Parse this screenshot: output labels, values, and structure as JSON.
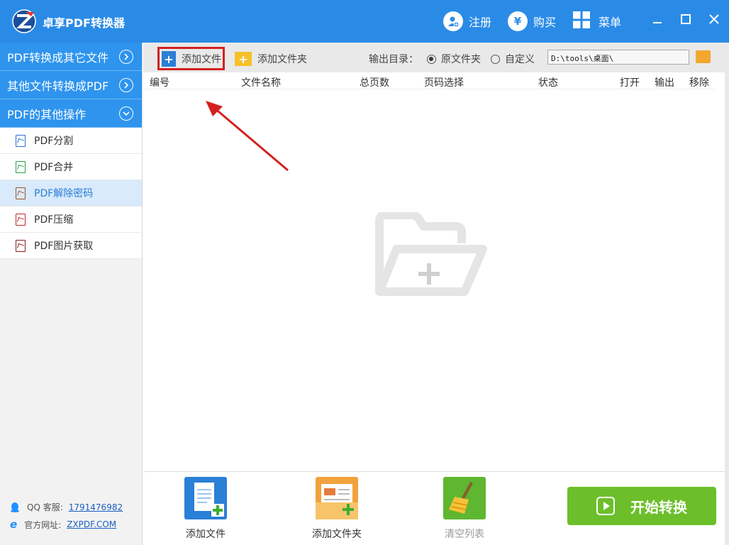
{
  "app": {
    "title": "卓享PDF转换器"
  },
  "titlebar": {
    "register": "注册",
    "buy": "购买",
    "menu": "菜单",
    "buy_symbol": "¥"
  },
  "sidebar": {
    "sections": [
      {
        "label": "PDF转换成其它文件"
      },
      {
        "label": "其他文件转换成PDF"
      },
      {
        "label": "PDF的其他操作"
      }
    ],
    "items": [
      {
        "label": "PDF分割",
        "color": "#2a6fd6"
      },
      {
        "label": "PDF合并",
        "color": "#27a046"
      },
      {
        "label": "PDF解除密码",
        "color": "#a0522d"
      },
      {
        "label": "PDF压缩",
        "color": "#c62828"
      },
      {
        "label": "PDF图片获取",
        "color": "#8b1a1a"
      }
    ],
    "active_item": "PDF解除密码",
    "footer": {
      "qq_label": "QQ 客服:",
      "qq_number": "1791476982",
      "site_label": "官方网址:",
      "site": "ZXPDF.COM"
    }
  },
  "toolbar": {
    "add_file": "添加文件",
    "add_folder": "添加文件夹",
    "output_label": "输出目录：",
    "option_source": "原文件夹",
    "option_custom": "自定义",
    "selected_option": "原文件夹",
    "path": "D:\\tools\\桌面\\"
  },
  "table": {
    "headers": [
      "编号",
      "文件名称",
      "总页数",
      "页码选择",
      "状态",
      "打开",
      "输出",
      "移除"
    ]
  },
  "bottom": {
    "add_file": "添加文件",
    "add_folder": "添加文件夹",
    "clear": "清空列表",
    "start": "开始转换"
  },
  "colors": {
    "accent": "#2a8be6",
    "start": "#6cbf2a",
    "highlight": "#d42020"
  }
}
